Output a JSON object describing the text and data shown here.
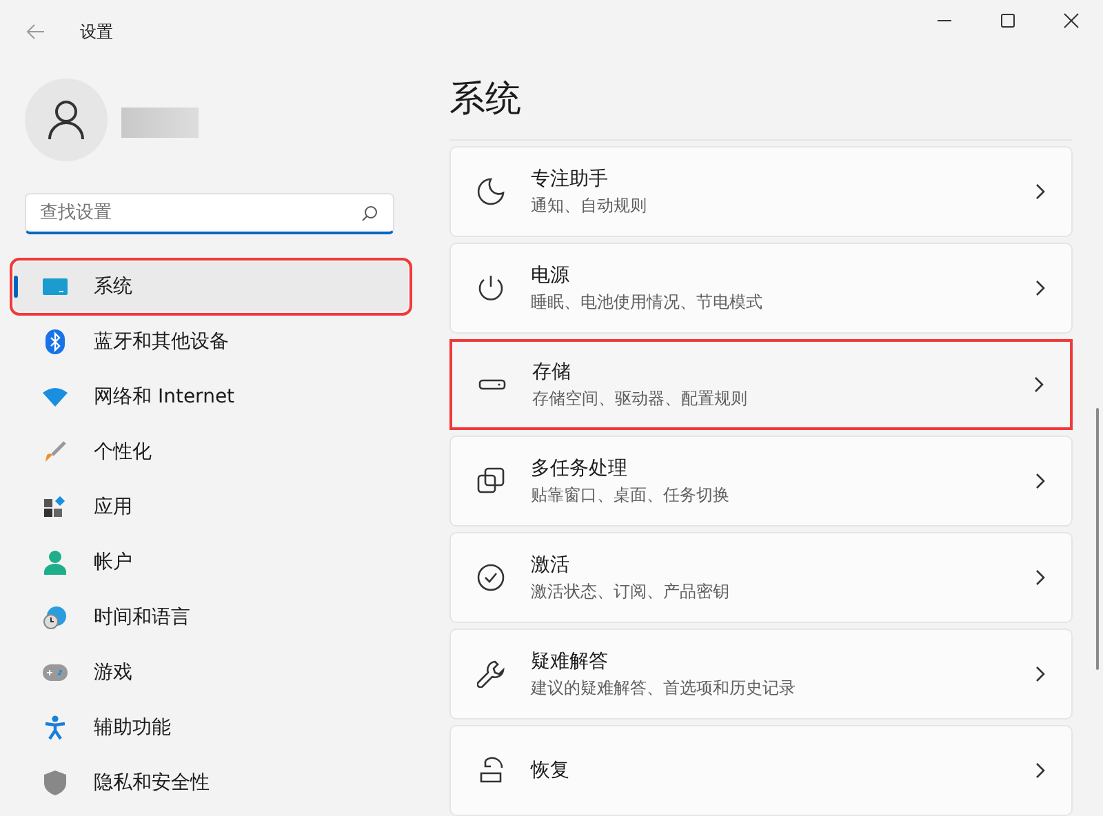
{
  "window": {
    "title": "设置"
  },
  "search": {
    "placeholder": "查找设置"
  },
  "sidebar": {
    "items": [
      {
        "label": "系统",
        "selected": true,
        "highlighted": true
      },
      {
        "label": "蓝牙和其他设备",
        "selected": false,
        "highlighted": false
      },
      {
        "label": "网络和 Internet",
        "selected": false,
        "highlighted": false
      },
      {
        "label": "个性化",
        "selected": false,
        "highlighted": false
      },
      {
        "label": "应用",
        "selected": false,
        "highlighted": false
      },
      {
        "label": "帐户",
        "selected": false,
        "highlighted": false
      },
      {
        "label": "时间和语言",
        "selected": false,
        "highlighted": false
      },
      {
        "label": "游戏",
        "selected": false,
        "highlighted": false
      },
      {
        "label": "辅助功能",
        "selected": false,
        "highlighted": false
      },
      {
        "label": "隐私和安全性",
        "selected": false,
        "highlighted": false
      }
    ]
  },
  "page": {
    "title": "系统",
    "cards": [
      {
        "title": "专注助手",
        "subtitle": "通知、自动规则",
        "highlighted": false
      },
      {
        "title": "电源",
        "subtitle": "睡眠、电池使用情况、节电模式",
        "highlighted": false
      },
      {
        "title": "存储",
        "subtitle": "存储空间、驱动器、配置规则",
        "highlighted": true
      },
      {
        "title": "多任务处理",
        "subtitle": "贴靠窗口、桌面、任务切换",
        "highlighted": false
      },
      {
        "title": "激活",
        "subtitle": "激活状态、订阅、产品密钥",
        "highlighted": false
      },
      {
        "title": "疑难解答",
        "subtitle": "建议的疑难解答、首选项和历史记录",
        "highlighted": false
      },
      {
        "title": "恢复",
        "highlighted": false
      }
    ]
  }
}
